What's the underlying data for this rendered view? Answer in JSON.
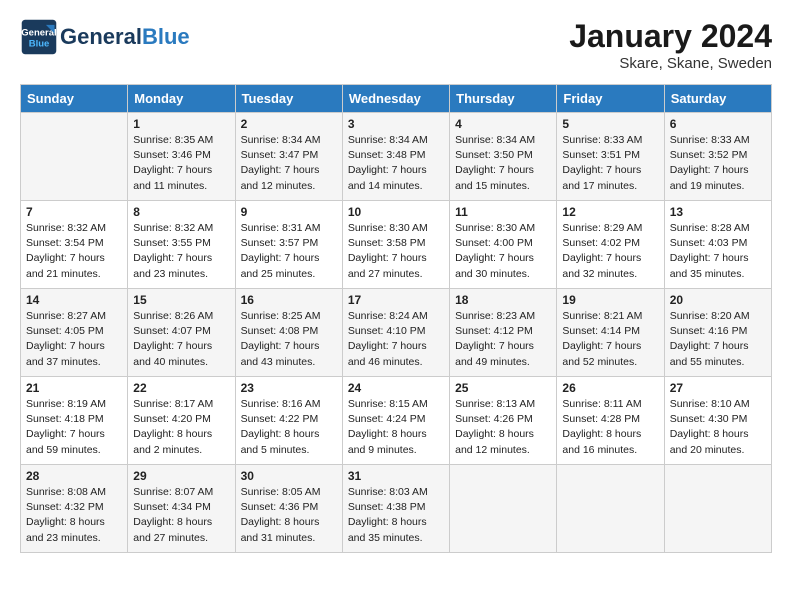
{
  "header": {
    "logo_line1": "General",
    "logo_line2": "Blue",
    "month": "January 2024",
    "location": "Skare, Skane, Sweden"
  },
  "days_of_week": [
    "Sunday",
    "Monday",
    "Tuesday",
    "Wednesday",
    "Thursday",
    "Friday",
    "Saturday"
  ],
  "weeks": [
    [
      {
        "day": "",
        "sunrise": "",
        "sunset": "",
        "daylight": ""
      },
      {
        "day": "1",
        "sunrise": "Sunrise: 8:35 AM",
        "sunset": "Sunset: 3:46 PM",
        "daylight": "Daylight: 7 hours and 11 minutes."
      },
      {
        "day": "2",
        "sunrise": "Sunrise: 8:34 AM",
        "sunset": "Sunset: 3:47 PM",
        "daylight": "Daylight: 7 hours and 12 minutes."
      },
      {
        "day": "3",
        "sunrise": "Sunrise: 8:34 AM",
        "sunset": "Sunset: 3:48 PM",
        "daylight": "Daylight: 7 hours and 14 minutes."
      },
      {
        "day": "4",
        "sunrise": "Sunrise: 8:34 AM",
        "sunset": "Sunset: 3:50 PM",
        "daylight": "Daylight: 7 hours and 15 minutes."
      },
      {
        "day": "5",
        "sunrise": "Sunrise: 8:33 AM",
        "sunset": "Sunset: 3:51 PM",
        "daylight": "Daylight: 7 hours and 17 minutes."
      },
      {
        "day": "6",
        "sunrise": "Sunrise: 8:33 AM",
        "sunset": "Sunset: 3:52 PM",
        "daylight": "Daylight: 7 hours and 19 minutes."
      }
    ],
    [
      {
        "day": "7",
        "sunrise": "Sunrise: 8:32 AM",
        "sunset": "Sunset: 3:54 PM",
        "daylight": "Daylight: 7 hours and 21 minutes."
      },
      {
        "day": "8",
        "sunrise": "Sunrise: 8:32 AM",
        "sunset": "Sunset: 3:55 PM",
        "daylight": "Daylight: 7 hours and 23 minutes."
      },
      {
        "day": "9",
        "sunrise": "Sunrise: 8:31 AM",
        "sunset": "Sunset: 3:57 PM",
        "daylight": "Daylight: 7 hours and 25 minutes."
      },
      {
        "day": "10",
        "sunrise": "Sunrise: 8:30 AM",
        "sunset": "Sunset: 3:58 PM",
        "daylight": "Daylight: 7 hours and 27 minutes."
      },
      {
        "day": "11",
        "sunrise": "Sunrise: 8:30 AM",
        "sunset": "Sunset: 4:00 PM",
        "daylight": "Daylight: 7 hours and 30 minutes."
      },
      {
        "day": "12",
        "sunrise": "Sunrise: 8:29 AM",
        "sunset": "Sunset: 4:02 PM",
        "daylight": "Daylight: 7 hours and 32 minutes."
      },
      {
        "day": "13",
        "sunrise": "Sunrise: 8:28 AM",
        "sunset": "Sunset: 4:03 PM",
        "daylight": "Daylight: 7 hours and 35 minutes."
      }
    ],
    [
      {
        "day": "14",
        "sunrise": "Sunrise: 8:27 AM",
        "sunset": "Sunset: 4:05 PM",
        "daylight": "Daylight: 7 hours and 37 minutes."
      },
      {
        "day": "15",
        "sunrise": "Sunrise: 8:26 AM",
        "sunset": "Sunset: 4:07 PM",
        "daylight": "Daylight: 7 hours and 40 minutes."
      },
      {
        "day": "16",
        "sunrise": "Sunrise: 8:25 AM",
        "sunset": "Sunset: 4:08 PM",
        "daylight": "Daylight: 7 hours and 43 minutes."
      },
      {
        "day": "17",
        "sunrise": "Sunrise: 8:24 AM",
        "sunset": "Sunset: 4:10 PM",
        "daylight": "Daylight: 7 hours and 46 minutes."
      },
      {
        "day": "18",
        "sunrise": "Sunrise: 8:23 AM",
        "sunset": "Sunset: 4:12 PM",
        "daylight": "Daylight: 7 hours and 49 minutes."
      },
      {
        "day": "19",
        "sunrise": "Sunrise: 8:21 AM",
        "sunset": "Sunset: 4:14 PM",
        "daylight": "Daylight: 7 hours and 52 minutes."
      },
      {
        "day": "20",
        "sunrise": "Sunrise: 8:20 AM",
        "sunset": "Sunset: 4:16 PM",
        "daylight": "Daylight: 7 hours and 55 minutes."
      }
    ],
    [
      {
        "day": "21",
        "sunrise": "Sunrise: 8:19 AM",
        "sunset": "Sunset: 4:18 PM",
        "daylight": "Daylight: 7 hours and 59 minutes."
      },
      {
        "day": "22",
        "sunrise": "Sunrise: 8:17 AM",
        "sunset": "Sunset: 4:20 PM",
        "daylight": "Daylight: 8 hours and 2 minutes."
      },
      {
        "day": "23",
        "sunrise": "Sunrise: 8:16 AM",
        "sunset": "Sunset: 4:22 PM",
        "daylight": "Daylight: 8 hours and 5 minutes."
      },
      {
        "day": "24",
        "sunrise": "Sunrise: 8:15 AM",
        "sunset": "Sunset: 4:24 PM",
        "daylight": "Daylight: 8 hours and 9 minutes."
      },
      {
        "day": "25",
        "sunrise": "Sunrise: 8:13 AM",
        "sunset": "Sunset: 4:26 PM",
        "daylight": "Daylight: 8 hours and 12 minutes."
      },
      {
        "day": "26",
        "sunrise": "Sunrise: 8:11 AM",
        "sunset": "Sunset: 4:28 PM",
        "daylight": "Daylight: 8 hours and 16 minutes."
      },
      {
        "day": "27",
        "sunrise": "Sunrise: 8:10 AM",
        "sunset": "Sunset: 4:30 PM",
        "daylight": "Daylight: 8 hours and 20 minutes."
      }
    ],
    [
      {
        "day": "28",
        "sunrise": "Sunrise: 8:08 AM",
        "sunset": "Sunset: 4:32 PM",
        "daylight": "Daylight: 8 hours and 23 minutes."
      },
      {
        "day": "29",
        "sunrise": "Sunrise: 8:07 AM",
        "sunset": "Sunset: 4:34 PM",
        "daylight": "Daylight: 8 hours and 27 minutes."
      },
      {
        "day": "30",
        "sunrise": "Sunrise: 8:05 AM",
        "sunset": "Sunset: 4:36 PM",
        "daylight": "Daylight: 8 hours and 31 minutes."
      },
      {
        "day": "31",
        "sunrise": "Sunrise: 8:03 AM",
        "sunset": "Sunset: 4:38 PM",
        "daylight": "Daylight: 8 hours and 35 minutes."
      },
      {
        "day": "",
        "sunrise": "",
        "sunset": "",
        "daylight": ""
      },
      {
        "day": "",
        "sunrise": "",
        "sunset": "",
        "daylight": ""
      },
      {
        "day": "",
        "sunrise": "",
        "sunset": "",
        "daylight": ""
      }
    ]
  ]
}
